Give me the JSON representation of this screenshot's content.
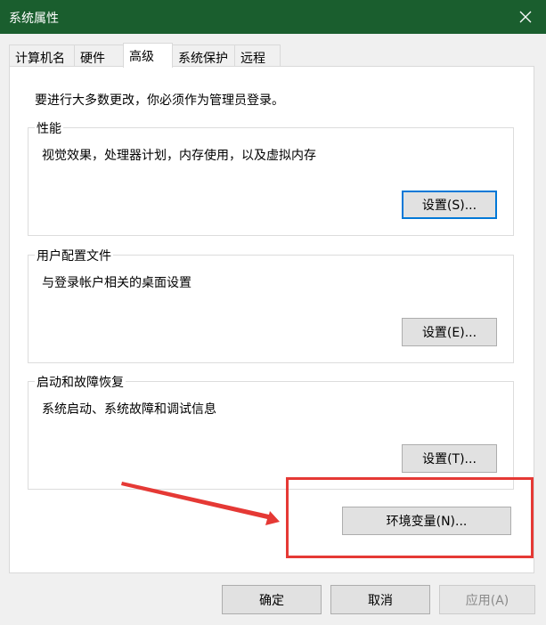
{
  "window": {
    "title": "系统属性"
  },
  "tabs": [
    {
      "label": "计算机名"
    },
    {
      "label": "硬件"
    },
    {
      "label": "高级"
    },
    {
      "label": "系统保护"
    },
    {
      "label": "远程"
    }
  ],
  "notice": "要进行大多数更改，你必须作为管理员登录。",
  "groups": {
    "performance": {
      "title": "性能",
      "desc": "视觉效果，处理器计划，内存使用，以及虚拟内存",
      "button": "设置(S)..."
    },
    "profiles": {
      "title": "用户配置文件",
      "desc": "与登录帐户相关的桌面设置",
      "button": "设置(E)..."
    },
    "startup": {
      "title": "启动和故障恢复",
      "desc": "系统启动、系统故障和调试信息",
      "button": "设置(T)..."
    }
  },
  "env_button": "环境变量(N)...",
  "footer": {
    "ok": "确定",
    "cancel": "取消",
    "apply": "应用(A)"
  },
  "colors": {
    "titlebar": "#1a5e2e",
    "annotation": "#e53935",
    "focus": "#0078d7"
  }
}
